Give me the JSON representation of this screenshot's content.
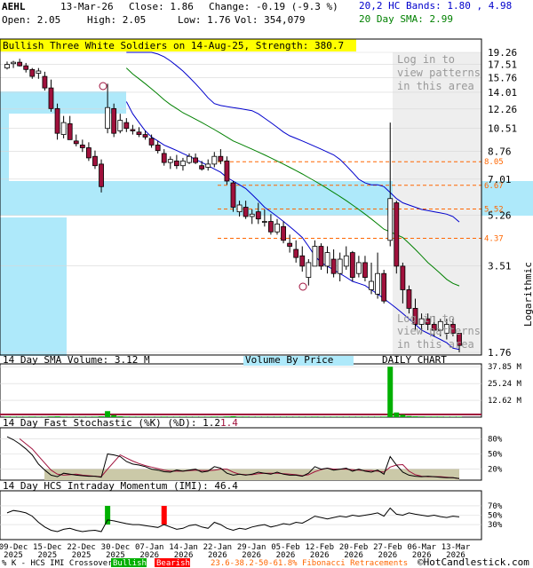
{
  "header": {
    "ticker": "AEHL",
    "date": "13-Mar-26",
    "close": "Close: 1.86",
    "change": "Change: -0.19 (-9.3 %)",
    "open": "Open: 2.05",
    "high": "High: 2.05",
    "low": "Low: 1.76",
    "vol": "Vol: 354,079",
    "bands": "20,2 HC Bands: 1.80 , 4.98",
    "sma": "20 Day SMA: 2.99"
  },
  "pattern_banner": "Bullish Three White Soldiers on 14-Aug-25, Strength: 380.7",
  "login_note": "Log in to view patterns in this area",
  "fib_levels": [
    "8.05",
    "6.67",
    "5.52",
    "4.37"
  ],
  "colors": {
    "up": "#ffffff",
    "down": "#a0113c",
    "outline": "#000000",
    "sma": "#008000",
    "band": "#0000cc",
    "fib": "#ff6600",
    "vbp": "#aee9fa",
    "volume_bar": "#00b000",
    "bullish": "#00b000",
    "bearish": "#ff0000",
    "stoch_k": "#000000",
    "stoch_d": "#a0113c",
    "banner": "#ffff00"
  },
  "panels": {
    "volume": {
      "label": "14 Day SMA Volume: 3.12 M",
      "vbp_label": "Volume By Price",
      "daily": "DAILY CHART",
      "ticks": [
        "37.85 M",
        "25.24 M",
        "12.62 M"
      ]
    },
    "stoch": {
      "label": "14 Day Fast Stochastic (%K) (%D): 1.2",
      "label2": "1.4",
      "ticks": [
        "80%",
        "50%",
        "20%"
      ]
    },
    "hcs": {
      "label": "14 Day HCS Intraday Momentum (IMI): 46.4",
      "ticks": [
        "70%",
        "50%",
        "30%"
      ]
    }
  },
  "log_label": "Logarithmic",
  "footer": {
    "legend": "% K - HCS IMI Crossover,",
    "bullish": "Bullish",
    "bearish": "Bearish",
    "fib": "23.6-38.2-50-61.8% Fibonacci Retracements",
    "copyright": "©HotCandlestick.com"
  },
  "chart_data": {
    "type": "candlestick",
    "y_scale": "log",
    "y_ticks": [
      "19.26",
      "17.51",
      "15.76",
      "14.01",
      "12.26",
      "10.51",
      "8.76",
      "7.01",
      "5.26",
      "3.51",
      "1.76"
    ],
    "x_tick_labels": [
      "09-Dec 2025",
      "15-Dec 2025",
      "22-Dec 2025",
      "30-Dec 2025",
      "07-Jan 2026",
      "14-Jan 2026",
      "22-Jan 2026",
      "29-Jan 2026",
      "05-Feb 2026",
      "12-Feb 2026",
      "20-Feb 2026",
      "27-Feb 2026",
      "06-Mar 2026",
      "13-Mar 2026"
    ],
    "candles": [
      [
        17.0,
        17.9,
        16.8,
        17.5
      ],
      [
        17.6,
        18.0,
        17.0,
        17.8
      ],
      [
        17.8,
        18.3,
        17.2,
        17.3
      ],
      [
        17.3,
        17.7,
        16.4,
        16.8
      ],
      [
        16.8,
        17.0,
        15.6,
        15.9
      ],
      [
        16.3,
        17.0,
        15.6,
        16.6
      ],
      [
        15.9,
        16.5,
        14.2,
        14.5
      ],
      [
        14.5,
        15.5,
        12.0,
        12.3
      ],
      [
        12.3,
        12.8,
        9.6,
        10.1
      ],
      [
        10.0,
        11.6,
        9.7,
        11.0
      ],
      [
        10.9,
        11.6,
        9.6,
        9.6
      ],
      [
        9.5,
        10.0,
        9.1,
        9.3
      ],
      [
        9.2,
        9.6,
        8.7,
        9.0
      ],
      [
        9.0,
        9.4,
        8.1,
        8.3
      ],
      [
        8.4,
        8.8,
        7.6,
        7.8
      ],
      [
        7.9,
        8.2,
        6.3,
        6.6
      ],
      [
        10.5,
        15.0,
        10.1,
        12.4
      ],
      [
        12.3,
        12.8,
        9.8,
        10.1
      ],
      [
        10.3,
        11.8,
        10.1,
        11.2
      ],
      [
        11.0,
        11.4,
        10.2,
        10.5
      ],
      [
        10.4,
        10.8,
        10.0,
        10.3
      ],
      [
        10.2,
        10.6,
        9.8,
        10.0
      ],
      [
        10.0,
        10.3,
        9.6,
        9.8
      ],
      [
        9.7,
        10.0,
        9.0,
        9.2
      ],
      [
        9.2,
        9.5,
        8.6,
        8.8
      ],
      [
        8.6,
        8.9,
        7.8,
        8.0
      ],
      [
        8.0,
        8.4,
        7.6,
        8.2
      ],
      [
        8.1,
        8.5,
        7.6,
        7.8
      ],
      [
        7.8,
        8.3,
        7.5,
        8.1
      ],
      [
        8.0,
        8.6,
        7.9,
        8.4
      ],
      [
        8.3,
        8.6,
        7.9,
        8.0
      ],
      [
        7.8,
        8.1,
        7.5,
        7.6
      ],
      [
        7.7,
        8.2,
        7.5,
        7.9
      ],
      [
        7.9,
        8.7,
        7.7,
        8.4
      ],
      [
        8.4,
        8.9,
        7.9,
        8.1
      ],
      [
        8.1,
        8.4,
        6.7,
        6.9
      ],
      [
        6.8,
        6.9,
        5.4,
        5.6
      ],
      [
        5.4,
        5.9,
        5.2,
        5.7
      ],
      [
        5.6,
        5.9,
        5.1,
        5.2
      ],
      [
        5.2,
        5.5,
        4.9,
        5.3
      ],
      [
        5.4,
        5.8,
        4.9,
        5.1
      ],
      [
        5.0,
        5.5,
        4.8,
        5.0
      ],
      [
        5.0,
        5.3,
        4.5,
        4.6
      ],
      [
        4.6,
        5.1,
        4.5,
        4.9
      ],
      [
        4.8,
        5.0,
        4.2,
        4.3
      ],
      [
        4.2,
        4.5,
        3.9,
        4.1
      ],
      [
        4.0,
        4.3,
        3.6,
        3.75
      ],
      [
        3.8,
        4.1,
        3.35,
        3.5
      ],
      [
        3.2,
        3.7,
        3.0,
        3.6
      ],
      [
        3.5,
        4.3,
        3.5,
        4.1
      ],
      [
        4.1,
        4.2,
        3.4,
        3.5
      ],
      [
        3.5,
        4.1,
        3.3,
        3.9
      ],
      [
        3.7,
        4.0,
        3.2,
        3.3
      ],
      [
        3.3,
        3.9,
        3.1,
        3.7
      ],
      [
        3.5,
        4.1,
        3.4,
        3.8
      ],
      [
        3.9,
        3.95,
        3.1,
        3.2
      ],
      [
        3.3,
        3.8,
        3.2,
        3.6
      ],
      [
        3.6,
        3.8,
        3.1,
        3.2
      ],
      [
        2.9,
        3.6,
        2.8,
        3.1
      ],
      [
        2.8,
        3.9,
        2.7,
        3.3
      ],
      [
        3.3,
        3.4,
        2.6,
        2.65
      ],
      [
        4.3,
        11.0,
        4.1,
        6.0
      ],
      [
        5.8,
        5.9,
        3.3,
        3.5
      ],
      [
        3.5,
        3.6,
        2.6,
        2.9
      ],
      [
        2.9,
        3.0,
        2.4,
        2.5
      ],
      [
        2.5,
        2.7,
        2.1,
        2.2
      ],
      [
        2.2,
        2.4,
        2.05,
        2.3
      ],
      [
        2.3,
        2.4,
        2.1,
        2.2
      ],
      [
        2.2,
        2.35,
        2.0,
        2.1
      ],
      [
        2.1,
        2.3,
        2.0,
        2.25
      ],
      [
        2.05,
        2.3,
        1.95,
        2.2
      ],
      [
        2.2,
        2.3,
        2.0,
        2.05
      ],
      [
        2.05,
        2.05,
        1.76,
        1.86
      ]
    ],
    "sma20": [
      null,
      null,
      null,
      null,
      null,
      null,
      null,
      null,
      null,
      null,
      null,
      null,
      null,
      null,
      null,
      null,
      null,
      null,
      null,
      17.0,
      16.2,
      15.6,
      15.0,
      14.4,
      13.8,
      13.2,
      12.7,
      12.3,
      11.9,
      11.6,
      11.3,
      11.0,
      10.7,
      10.4,
      10.1,
      9.8,
      9.5,
      9.3,
      9.1,
      8.9,
      8.7,
      8.5,
      8.3,
      8.1,
      7.9,
      7.7,
      7.5,
      7.3,
      7.1,
      6.9,
      6.7,
      6.5,
      6.3,
      6.1,
      5.9,
      5.7,
      5.5,
      5.3,
      5.1,
      4.9,
      4.7,
      4.6,
      4.5,
      4.4,
      4.2,
      4.0,
      3.8,
      3.6,
      3.45,
      3.3,
      3.15,
      3.05,
      2.99
    ],
    "upper_band": [
      null,
      null,
      null,
      null,
      null,
      null,
      null,
      null,
      null,
      null,
      null,
      null,
      null,
      null,
      null,
      null,
      null,
      null,
      null,
      19.26,
      19.26,
      19.26,
      19.26,
      19.26,
      19.0,
      18.6,
      18.0,
      17.3,
      16.6,
      15.8,
      15.0,
      14.2,
      13.4,
      12.8,
      12.6,
      12.5,
      12.4,
      12.3,
      12.2,
      12.1,
      11.8,
      11.4,
      11.0,
      10.6,
      10.2,
      9.9,
      9.7,
      9.5,
      9.3,
      9.1,
      8.9,
      8.7,
      8.5,
      8.2,
      7.8,
      7.4,
      7.0,
      6.8,
      6.7,
      6.7,
      6.6,
      6.3,
      6.0,
      5.8,
      5.7,
      5.6,
      5.5,
      5.45,
      5.4,
      5.35,
      5.3,
      5.2,
      4.98
    ],
    "lower_band": [
      null,
      null,
      null,
      null,
      null,
      null,
      null,
      null,
      null,
      null,
      null,
      null,
      null,
      null,
      null,
      null,
      null,
      null,
      null,
      13.0,
      11.8,
      11.0,
      10.3,
      9.8,
      9.5,
      9.2,
      9.0,
      8.8,
      8.6,
      8.4,
      8.2,
      8.0,
      7.8,
      7.6,
      7.4,
      7.1,
      6.9,
      6.7,
      6.5,
      6.2,
      5.9,
      5.6,
      5.4,
      5.2,
      5.0,
      4.8,
      4.6,
      4.4,
      4.1,
      3.8,
      3.6,
      3.5,
      3.4,
      3.3,
      3.2,
      3.1,
      3.05,
      3.0,
      2.9,
      2.8,
      2.7,
      2.6,
      2.5,
      2.4,
      2.3,
      2.2,
      2.1,
      2.05,
      2.0,
      1.95,
      1.9,
      1.82,
      1.8
    ],
    "volume": [
      0.4,
      0.3,
      0.3,
      0.3,
      0.4,
      0.3,
      0.3,
      0.5,
      0.6,
      0.4,
      0.3,
      0.3,
      0.3,
      0.3,
      0.4,
      0.6,
      4.5,
      1.5,
      0.6,
      0.4,
      0.3,
      0.3,
      0.3,
      0.3,
      0.3,
      0.4,
      0.3,
      0.3,
      0.3,
      0.3,
      0.3,
      0.3,
      0.3,
      0.4,
      0.3,
      0.5,
      0.7,
      0.4,
      0.4,
      0.3,
      0.3,
      0.3,
      0.3,
      0.3,
      0.3,
      0.3,
      0.3,
      0.3,
      0.3,
      0.4,
      0.3,
      0.3,
      0.3,
      0.3,
      0.3,
      0.3,
      0.3,
      0.3,
      0.3,
      0.3,
      0.4,
      37.85,
      3.5,
      1.8,
      0.8,
      0.6,
      0.5,
      0.4,
      0.4,
      0.4,
      0.3,
      0.3,
      0.35
    ],
    "stoch_k": [
      84,
      78,
      70,
      60,
      48,
      30,
      18,
      8,
      5,
      12,
      10,
      8,
      7,
      6,
      6,
      4,
      50,
      48,
      45,
      35,
      30,
      28,
      25,
      20,
      18,
      15,
      14,
      18,
      16,
      18,
      20,
      14,
      16,
      25,
      22,
      12,
      8,
      10,
      8,
      10,
      14,
      12,
      10,
      14,
      10,
      8,
      8,
      6,
      12,
      25,
      20,
      22,
      18,
      20,
      22,
      16,
      20,
      16,
      14,
      18,
      10,
      45,
      28,
      14,
      8,
      6,
      5,
      6,
      5,
      4,
      3,
      3,
      1.2
    ],
    "stoch_d": [
      null,
      null,
      80,
      70,
      60,
      46,
      32,
      18,
      10,
      8,
      9,
      10,
      8,
      7,
      6,
      5,
      20,
      34,
      48,
      42,
      36,
      31,
      27,
      24,
      21,
      18,
      16,
      16,
      16,
      17,
      18,
      17,
      17,
      18,
      20,
      20,
      14,
      10,
      9,
      9,
      11,
      12,
      12,
      12,
      11,
      10,
      9,
      7,
      9,
      15,
      19,
      22,
      20,
      20,
      20,
      19,
      18,
      17,
      17,
      16,
      14,
      24,
      28,
      29,
      16,
      9,
      6,
      5,
      5,
      5,
      4,
      3,
      1.4
    ],
    "imi": [
      55,
      60,
      58,
      55,
      48,
      35,
      25,
      18,
      15,
      20,
      22,
      18,
      15,
      17,
      18,
      15,
      40,
      38,
      35,
      32,
      30,
      30,
      28,
      26,
      24,
      30,
      25,
      20,
      22,
      28,
      30,
      25,
      22,
      35,
      30,
      22,
      18,
      22,
      20,
      25,
      28,
      30,
      25,
      28,
      32,
      30,
      35,
      33,
      40,
      48,
      45,
      42,
      45,
      48,
      46,
      50,
      48,
      50,
      52,
      55,
      48,
      65,
      52,
      50,
      55,
      52,
      50,
      48,
      50,
      47,
      45,
      48,
      46.4
    ],
    "signals": [
      {
        "index": 16,
        "type": "Bullish"
      },
      {
        "index": 25,
        "type": "Bearish"
      }
    ],
    "vbp_levels": [
      {
        "price": 10.5,
        "weight": 0.7
      },
      {
        "price": 6.0,
        "weight": 1.0
      },
      {
        "price": 2.2,
        "weight": 0.4
      }
    ]
  }
}
